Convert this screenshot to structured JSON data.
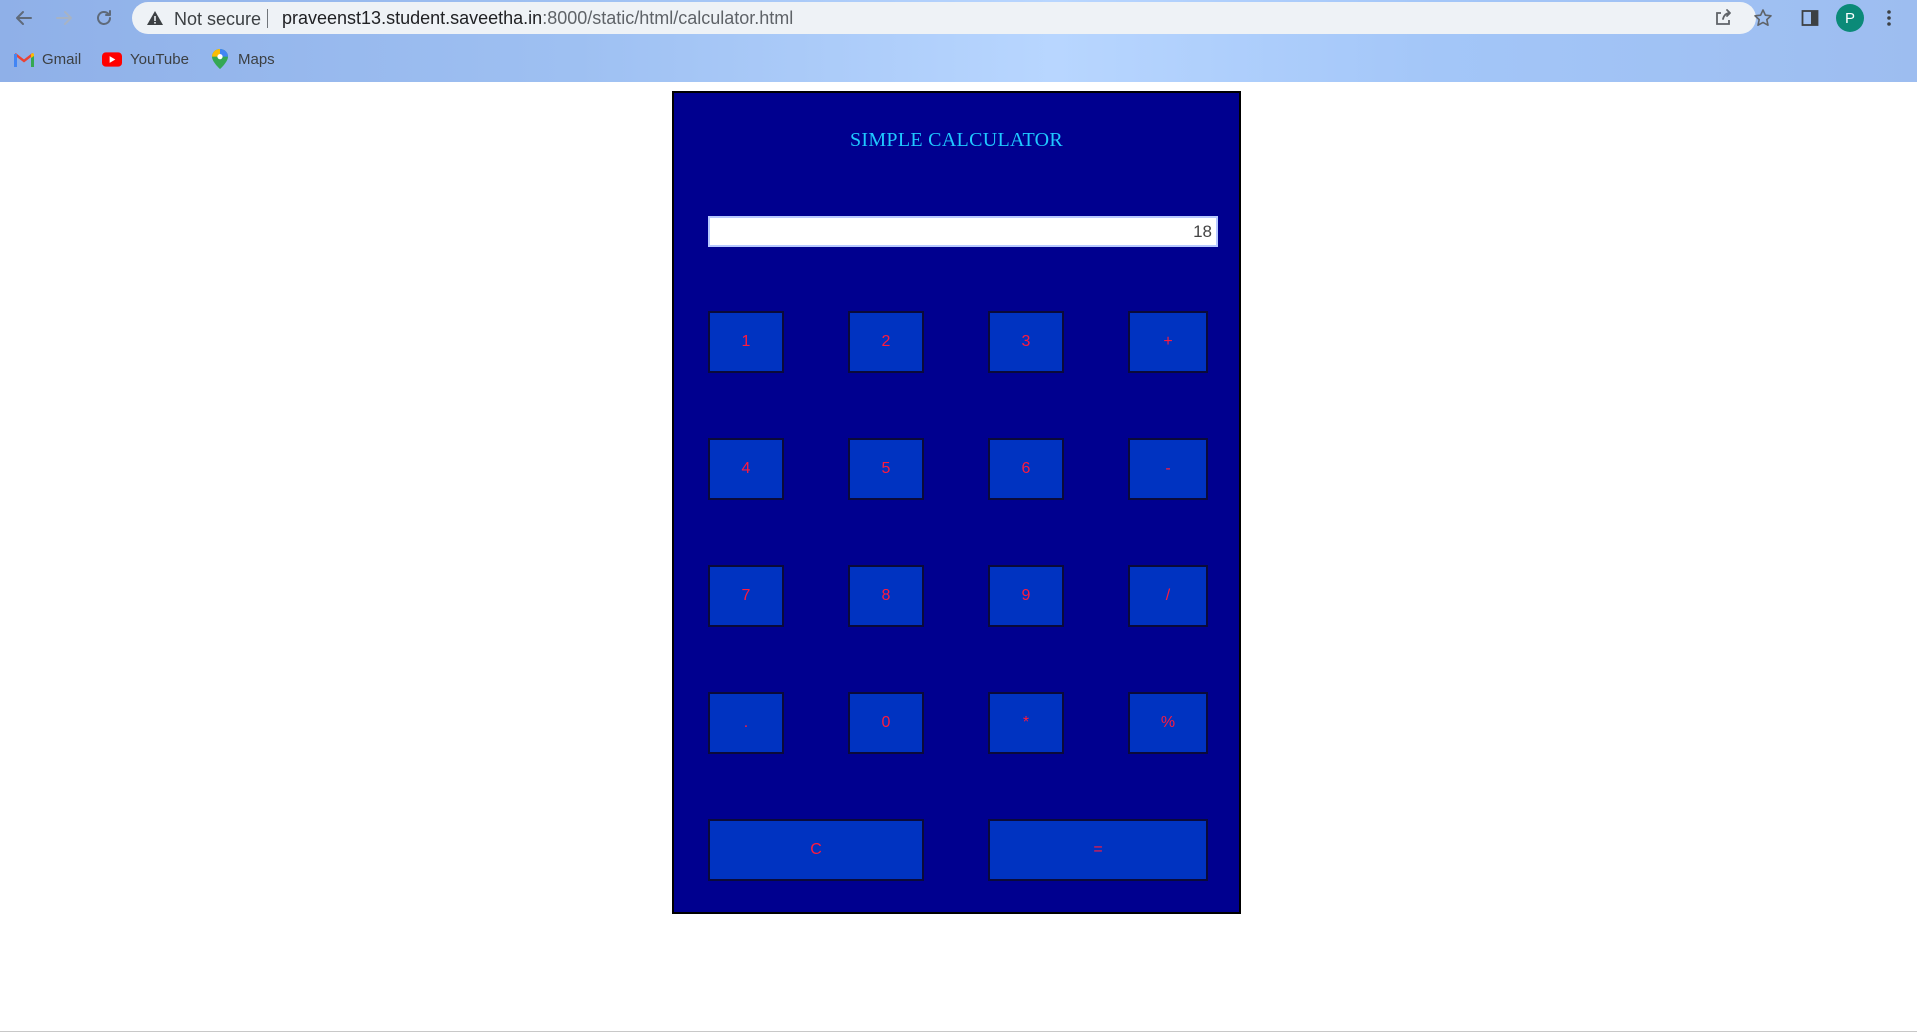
{
  "browser": {
    "security_label": "Not secure",
    "url_host": "praveenst13.student.saveetha.in",
    "url_rest": ":8000/static/html/calculator.html",
    "profile_initial": "P",
    "bookmarks": [
      {
        "label": "Gmail"
      },
      {
        "label": "YouTube"
      },
      {
        "label": "Maps"
      }
    ]
  },
  "calculator": {
    "title": "SIMPLE CALCULATOR",
    "display_value": "18",
    "keys": {
      "k1": "1",
      "k2": "2",
      "k3": "3",
      "plus": "+",
      "k4": "4",
      "k5": "5",
      "k6": "6",
      "minus": "-",
      "k7": "7",
      "k8": "8",
      "k9": "9",
      "divide": "/",
      "dot": ".",
      "k0": "0",
      "multiply": "*",
      "percent": "%",
      "clear": "C",
      "equals": "="
    }
  },
  "colors": {
    "panel_bg": "#00008f",
    "key_bg": "#0033c1",
    "key_text": "#ff1a3d",
    "title_text": "#1fc8ff",
    "avatar_bg": "#0b8a78"
  }
}
